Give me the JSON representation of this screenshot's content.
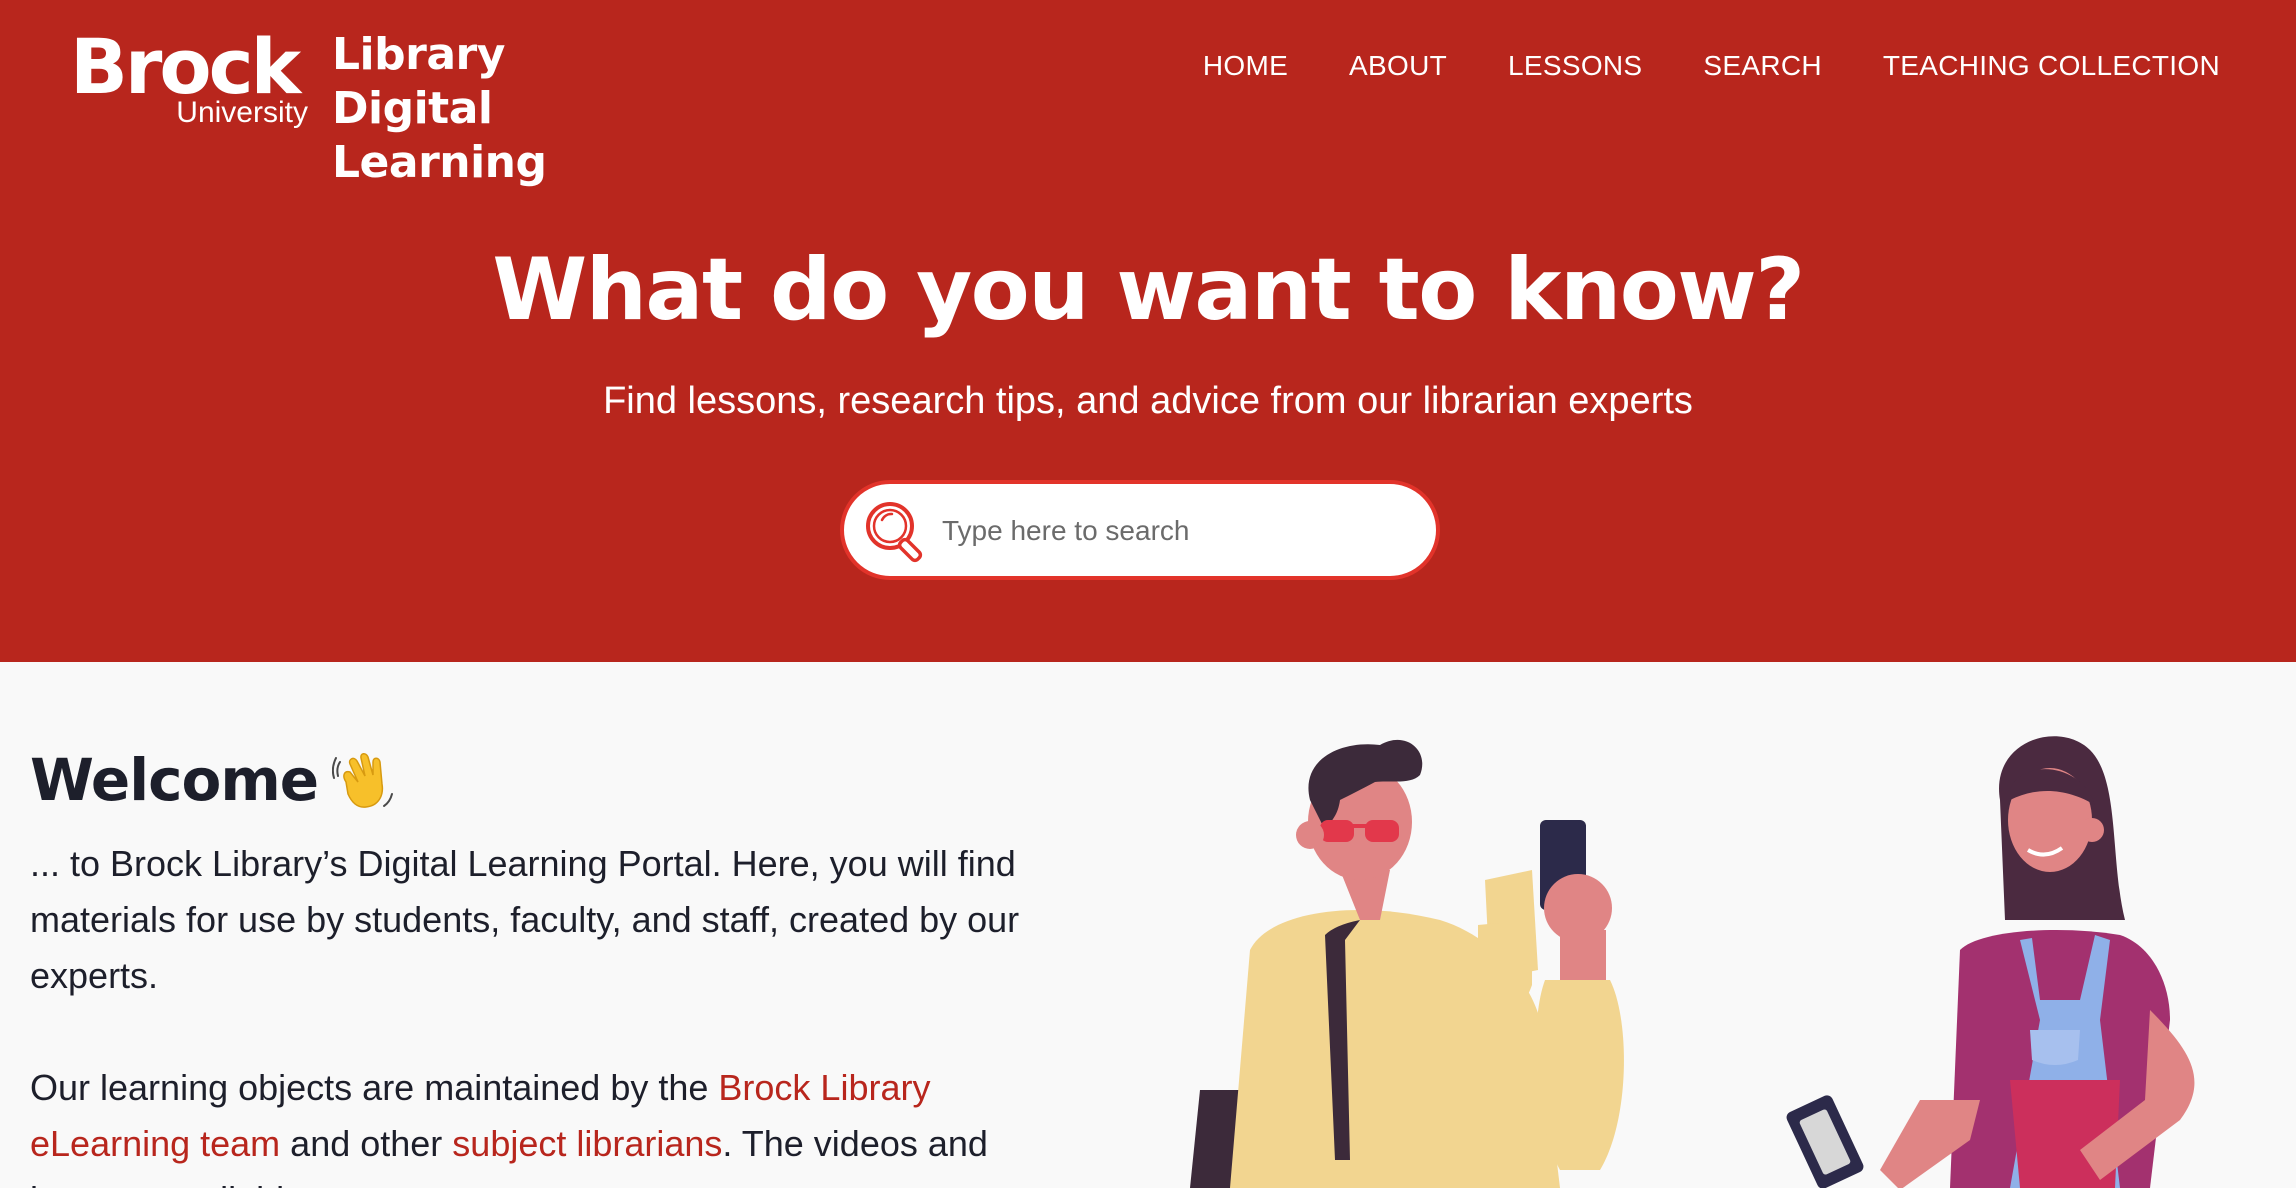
{
  "header": {
    "logo_word": "Brock",
    "logo_sub": "University",
    "site_title": "Library Digital Learning",
    "nav": [
      {
        "label": "HOME"
      },
      {
        "label": "ABOUT"
      },
      {
        "label": "LESSONS"
      },
      {
        "label": "SEARCH"
      },
      {
        "label": "TEACHING COLLECTION"
      }
    ]
  },
  "hero": {
    "title": "What do you want to know?",
    "subtitle": "Find lessons, research tips, and advice from our librarian experts",
    "search": {
      "placeholder": "Type here to search",
      "icon": "magnifier-icon"
    }
  },
  "main": {
    "welcome_heading": "Welcome",
    "welcome_icon": "waving-hand-icon",
    "paragraph1": "... to Brock Library’s Digital Learning Portal. Here, you will find materials for use by students, faculty, and staff, created by our experts.",
    "paragraph2": {
      "part1": "Our learning objects are maintained by the ",
      "link1": "Brock Library eLearning team",
      "part2": " and other ",
      "link2": "subject librarians",
      "part3": ". The videos and lessons available"
    }
  },
  "colors": {
    "brand_red": "#b8261d",
    "search_border": "#e2332a",
    "text_dark": "#1d1f2b",
    "page_bg": "#f9f9f9"
  }
}
